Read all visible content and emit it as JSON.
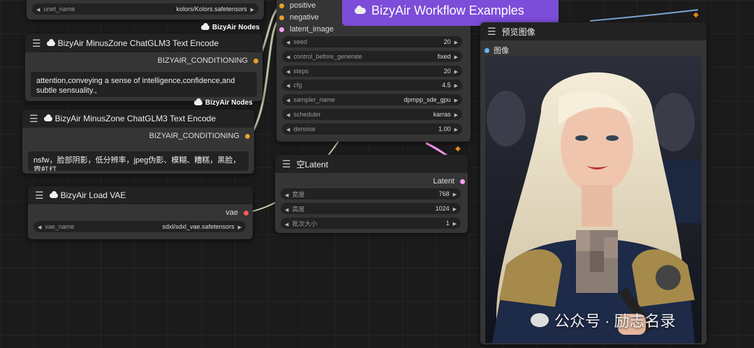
{
  "banner": {
    "title": "BizyAir Workflow Examples"
  },
  "unet_widget": {
    "label": "unet_name",
    "value": "kolors/Kolors.safetensors"
  },
  "badges": {
    "bizyair_nodes_1": "BizyAir Nodes",
    "bizyair_nodes_2": "BizyAir Nodes"
  },
  "encode_node_1": {
    "title": "BizyAir MinusZone ChatGLM3 Text Encode",
    "output": "BIZYAIR_CONDITIONING",
    "text": "attention,conveying a sense of intelligence,confidence,and subtle sensuality.,"
  },
  "encode_node_2": {
    "title": "BizyAir MinusZone ChatGLM3 Text Encode",
    "output": "BIZYAIR_CONDITIONING",
    "text": "nsfw，脸部阴影，低分辨率，jpeg伪影、模糊、糟糕，黑脸，霓虹灯"
  },
  "vae_node": {
    "title": "BizyAir Load VAE",
    "output": "vae",
    "widget_label": "vae_name",
    "widget_value": "sdxl/sdxl_vae.safetensors"
  },
  "sampler_inputs": {
    "positive": "positive",
    "negative": "negative",
    "latent_image": "latent_image"
  },
  "sampler_widgets": [
    {
      "label": "seed",
      "value": "20"
    },
    {
      "label": "control_before_generate",
      "value": "fixed"
    },
    {
      "label": "steps",
      "value": "20"
    },
    {
      "label": "cfg",
      "value": "4.5"
    },
    {
      "label": "sampler_name",
      "value": "dpmpp_sde_gpu"
    },
    {
      "label": "scheduler",
      "value": "karras"
    },
    {
      "label": "denoise",
      "value": "1.00"
    }
  ],
  "latent_node": {
    "title": "空Latent",
    "output": "Latent",
    "widgets": [
      {
        "label": "宽度",
        "value": "768"
      },
      {
        "label": "高度",
        "value": "1024"
      },
      {
        "label": "批次大小",
        "value": "1"
      }
    ]
  },
  "preview_node": {
    "title": "预览图像",
    "input": "图像"
  },
  "watermark": {
    "text": "公众号 · 励志名录"
  },
  "colors": {
    "banner": "#7c4dd8",
    "conditioning_dot": "#e6a12a",
    "vae_dot": "#ff5a5a",
    "latent_dot": "#ff9cf9",
    "image_dot": "#64b5f6",
    "fox": "#e8841a"
  }
}
